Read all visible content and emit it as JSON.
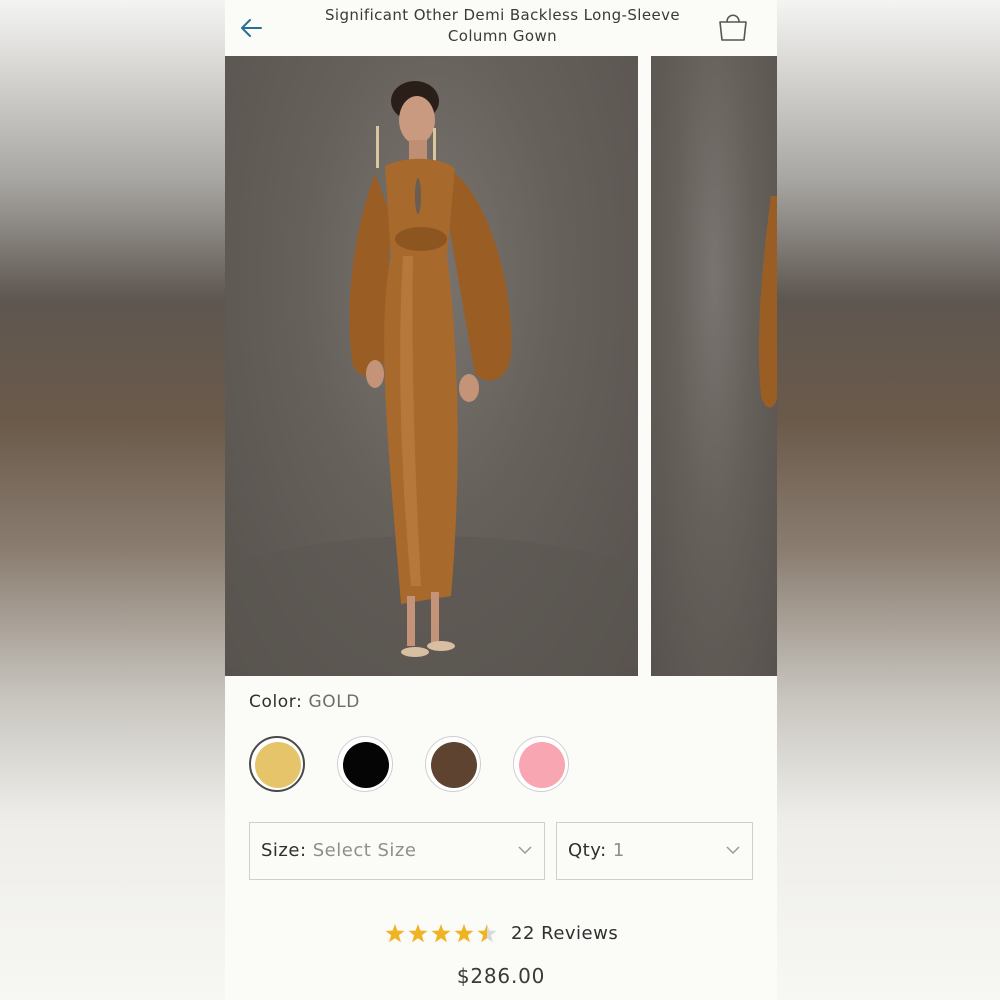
{
  "header": {
    "title_line1": "Significant Other Demi Backless Long-Sleeve",
    "title_line2": "Column Gown",
    "back_icon": "arrow-left-icon",
    "bag_icon": "shopping-bag-icon",
    "icon_color": "#2a6f93"
  },
  "gallery": {
    "image_count_visible": 2,
    "dress_color": "#a8692c"
  },
  "color": {
    "label": "Color:",
    "selected": "GOLD",
    "swatches": [
      {
        "hex": "#e6c56a",
        "selected": true
      },
      {
        "hex": "#050505",
        "selected": false
      },
      {
        "hex": "#5e4330",
        "selected": false
      },
      {
        "hex": "#f7a6b2",
        "selected": false
      }
    ]
  },
  "size": {
    "label": "Size:",
    "value": "Select Size"
  },
  "qty": {
    "label": "Qty:",
    "value": "1"
  },
  "rating": {
    "stars": 4.5,
    "max": 5,
    "reviews_text": "22 Reviews",
    "star_color": "#f0b323"
  },
  "price": "$286.00"
}
